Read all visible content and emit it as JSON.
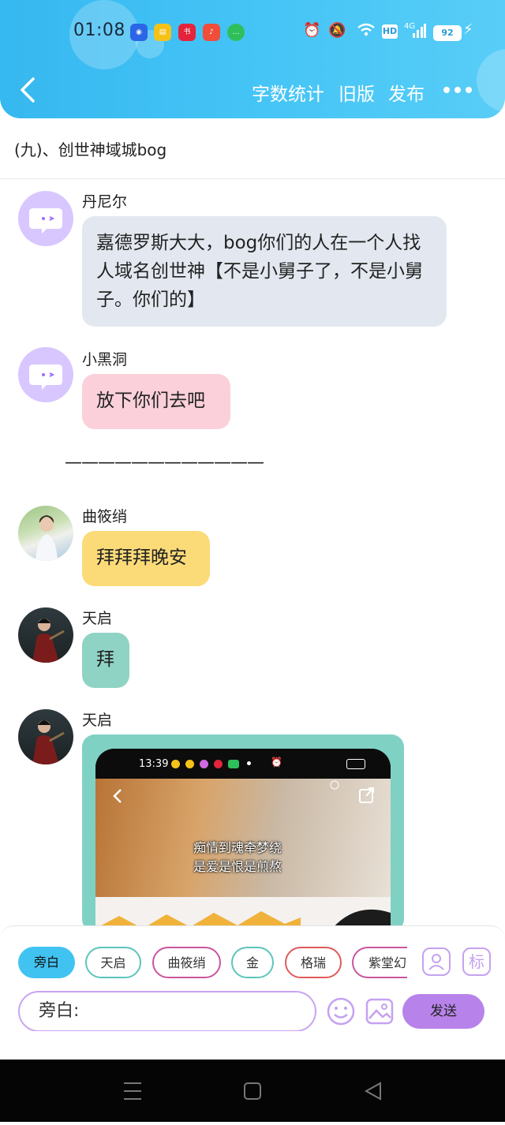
{
  "status_bar": {
    "time": "01:08",
    "battery": "92",
    "network": "4G",
    "hd": "HD"
  },
  "header": {
    "back_icon": "chevron-left-icon",
    "word_count_label": "字数统计",
    "old_version_label": "旧版",
    "publish_label": "发布",
    "more_icon": "more-dots-icon"
  },
  "chapter": {
    "title": "(九)、创世神域城bog"
  },
  "messages": [
    {
      "name": "丹尼尔",
      "avatar": "default-chat-avatar",
      "text": "嘉德罗斯大大，bog你们的人在一个人找人域名创世神【不是小舅子了，不是小舅子。你们的】",
      "color": "#e3e8f0"
    },
    {
      "name": "小黑洞",
      "avatar": "default-chat-avatar",
      "text": "放下你们去吧",
      "color": "#fbd0da"
    },
    {
      "name": "曲筱绡",
      "avatar": "photo-avatar",
      "text": "拜拜拜晚安",
      "color": "#fbdb78"
    },
    {
      "name": "天启",
      "avatar": "photo-avatar",
      "text": "拜",
      "color": "#8fd3c5"
    },
    {
      "name": "天启",
      "avatar": "photo-avatar",
      "text": "",
      "color": "#7fd1c4"
    }
  ],
  "narration_separator": "————————————",
  "image_message": {
    "phone_time": "13:39",
    "caption_line1": "痴情到魂牵梦绕",
    "caption_line2": "是爱是恨是煎熬"
  },
  "character_chips": [
    {
      "label": "旁白",
      "selected": true,
      "color": "#41c3f1"
    },
    {
      "label": "天启",
      "selected": false,
      "color": "#5cc5bb"
    },
    {
      "label": "曲筱绡",
      "selected": false,
      "color": "#c9559d"
    },
    {
      "label": "金",
      "selected": false,
      "color": "#5cc5bb"
    },
    {
      "label": "格瑞",
      "selected": false,
      "color": "#e05a5a"
    },
    {
      "label": "紫堂幻",
      "selected": false,
      "color": "#c9559d"
    }
  ],
  "side_icons": {
    "person_icon": "person-card-icon",
    "mark_label": "标"
  },
  "composer": {
    "input_value": "旁白:",
    "emoji_icon": "emoji-icon",
    "image_icon": "image-icon",
    "send_label": "发送"
  }
}
